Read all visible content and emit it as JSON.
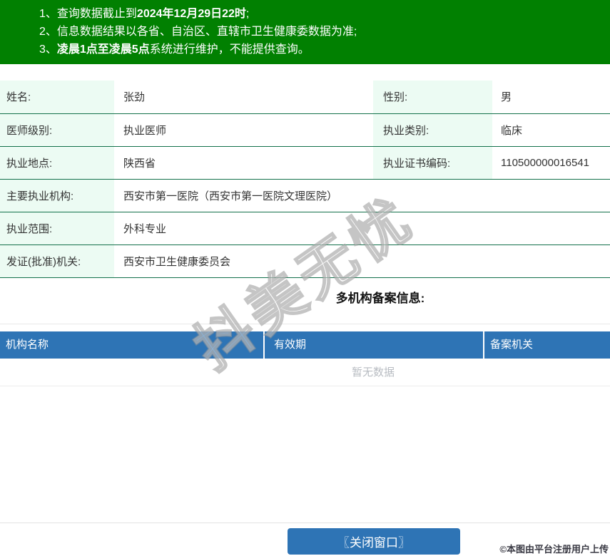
{
  "colors": {
    "banner_green": "#018001",
    "header_blue": "#2e74b5",
    "label_mint": "#ecfbf3",
    "row_border_green": "#12704a"
  },
  "notice": {
    "lines": [
      {
        "num": "1、",
        "pre": "查询数据截止到",
        "bold": "2024年12月29日22时",
        "post": ";"
      },
      {
        "num": "2、",
        "pre": "信息数据结果以各省、自治区、直辖市卫生健康委数据为准;",
        "bold": "",
        "post": ""
      },
      {
        "num": "3、",
        "pre": "",
        "bold": "凌晨1点至凌晨5点",
        "post": "系统进行维护，不能提供查询。"
      }
    ]
  },
  "info": {
    "rows": [
      {
        "label1": "姓名:",
        "value1": "张劲",
        "label2": "性别:",
        "value2": "男"
      },
      {
        "label1": "医师级别:",
        "value1": "执业医师",
        "label2": "执业类别:",
        "value2": "临床"
      },
      {
        "label1": "执业地点:",
        "value1": "陕西省",
        "label2": "执业证书编码:",
        "value2": "110500000016541"
      },
      {
        "label1": "主要执业机构:",
        "value1": "西安市第一医院（西安市第一医院文理医院）"
      },
      {
        "label1": "执业范围:",
        "value1": "外科专业"
      },
      {
        "label1": "发证(批准)机关:",
        "value1": "西安市卫生健康委员会"
      }
    ]
  },
  "records": {
    "title": "多机构备案信息:",
    "columns": [
      "机构名称",
      "有效期",
      "备案机关"
    ],
    "empty_text": "暂无数据"
  },
  "footer": {
    "close_button": "〖关闭窗口〗",
    "credit": "©本图由平台注册用户上传"
  },
  "watermark": {
    "text": "抖美无忧"
  }
}
